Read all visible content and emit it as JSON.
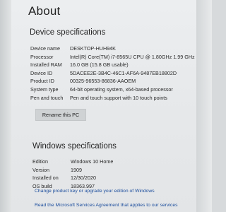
{
  "page": {
    "title": "About"
  },
  "device_specs": {
    "heading": "Device specifications",
    "rows": [
      {
        "label": "Device name",
        "value": "DESKTOP-HUH94K"
      },
      {
        "label": "Processor",
        "value": "Intel(R) Core(TM) i7-8565U CPU @ 1.80GHz   1.99 GHz"
      },
      {
        "label": "Installed RAM",
        "value": "16.0 GB (15.8 GB usable)"
      },
      {
        "label": "Device ID",
        "value": "5DACEE2E-3B4C-46C1-AF6A-9487EB18802D"
      },
      {
        "label": "Product ID",
        "value": "00325-96553-86836-AAOEM"
      },
      {
        "label": "System type",
        "value": "64-bit operating system, x64-based processor"
      },
      {
        "label": "Pen and touch",
        "value": "Pen and touch support with 10 touch points"
      }
    ],
    "rename_button": "Rename this PC"
  },
  "windows_specs": {
    "heading": "Windows specifications",
    "rows": [
      {
        "label": "Edition",
        "value": "Windows 10 Home"
      },
      {
        "label": "Version",
        "value": "1909"
      },
      {
        "label": "Installed on",
        "value": "12/30/2020"
      },
      {
        "label": "OS build",
        "value": "18363.997"
      }
    ],
    "change_key_link": "Change product key or upgrade your edition of Windows",
    "msa_link": "Read the Microsoft Services Agreement that applies to our services"
  },
  "colors": {
    "link": "#1a4c9c",
    "background": "#e8eaec",
    "button": "#cfd2d4"
  }
}
